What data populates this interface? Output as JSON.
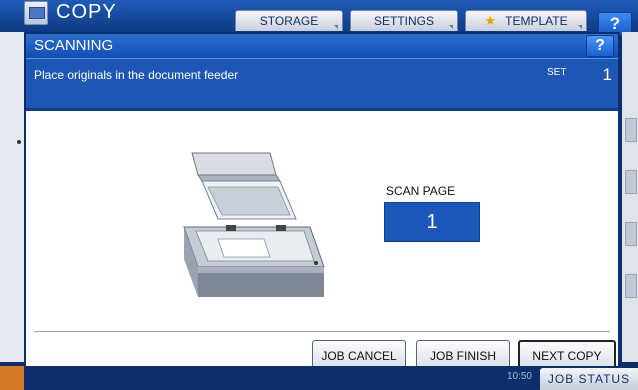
{
  "header": {
    "app_title": "COPY",
    "tabs": [
      {
        "label": "STORAGE"
      },
      {
        "label": "SETTINGS"
      },
      {
        "label": "TEMPLATE"
      }
    ],
    "help": "?"
  },
  "dialog": {
    "title": "SCANNING",
    "help": "?",
    "message": "Place originals in the document feeder",
    "set_label": "SET",
    "set_value": "1",
    "scan_page_label": "SCAN PAGE",
    "scan_page_value": "1",
    "buttons": {
      "job_cancel": "JOB CANCEL",
      "job_finish": "JOB FINISH",
      "next_copy": "NEXT COPY"
    }
  },
  "footer": {
    "time": "10:50",
    "job_status": "JOB STATUS"
  },
  "colors": {
    "title_blue": "#1f5db8",
    "message_blue": "#1d56b4",
    "accent_orange": "#d77a28"
  }
}
